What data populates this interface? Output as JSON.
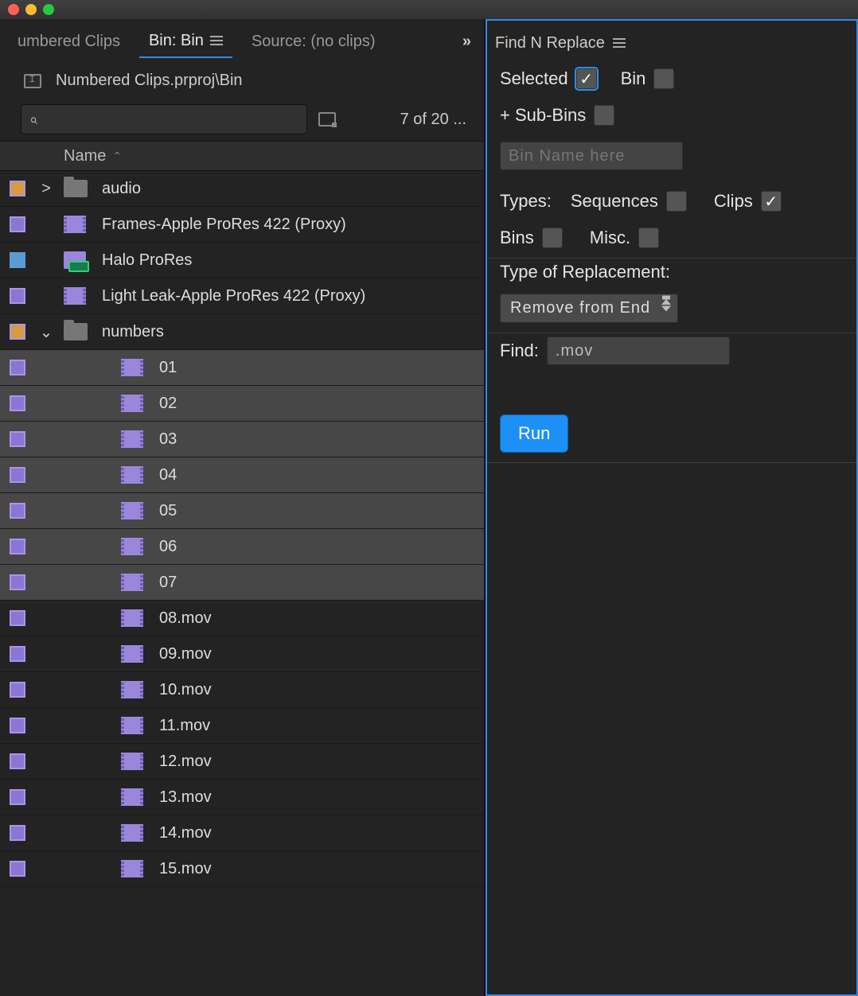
{
  "tabs": {
    "left": [
      {
        "label": "umbered Clips",
        "active": false,
        "menu": false
      },
      {
        "label": "Bin: Bin",
        "active": true,
        "menu": true
      },
      {
        "label": "Source: (no clips)",
        "active": false,
        "menu": false
      }
    ],
    "right": {
      "label": "Find N Replace"
    }
  },
  "breadcrumb": "Numbered Clips.prproj\\Bin",
  "search": {
    "placeholder": ""
  },
  "count_text": "7 of 20 ...",
  "list_header": {
    "col": "Name"
  },
  "rows": [
    {
      "kind": "folder",
      "name": "audio",
      "indent": 0,
      "chevron": ">",
      "selected": false
    },
    {
      "kind": "clip",
      "name": "Frames-Apple ProRes 422 (Proxy)",
      "indent": 0,
      "selected": false
    },
    {
      "kind": "seq",
      "name": "Halo ProRes",
      "indent": 0,
      "selected": false
    },
    {
      "kind": "clip",
      "name": "Light Leak-Apple ProRes 422 (Proxy)",
      "indent": 0,
      "selected": false
    },
    {
      "kind": "folder",
      "name": "numbers",
      "indent": 0,
      "chevron": "⌄",
      "selected": false
    },
    {
      "kind": "clip",
      "name": "01",
      "indent": 1,
      "selected": true
    },
    {
      "kind": "clip",
      "name": "02",
      "indent": 1,
      "selected": true
    },
    {
      "kind": "clip",
      "name": "03",
      "indent": 1,
      "selected": true
    },
    {
      "kind": "clip",
      "name": "04",
      "indent": 1,
      "selected": true
    },
    {
      "kind": "clip",
      "name": "05",
      "indent": 1,
      "selected": true
    },
    {
      "kind": "clip",
      "name": "06",
      "indent": 1,
      "selected": true
    },
    {
      "kind": "clip",
      "name": "07",
      "indent": 1,
      "selected": true
    },
    {
      "kind": "clip",
      "name": "08.mov",
      "indent": 1,
      "selected": false
    },
    {
      "kind": "clip",
      "name": "09.mov",
      "indent": 1,
      "selected": false
    },
    {
      "kind": "clip",
      "name": "10.mov",
      "indent": 1,
      "selected": false
    },
    {
      "kind": "clip",
      "name": "11.mov",
      "indent": 1,
      "selected": false
    },
    {
      "kind": "clip",
      "name": "12.mov",
      "indent": 1,
      "selected": false
    },
    {
      "kind": "clip",
      "name": "13.mov",
      "indent": 1,
      "selected": false
    },
    {
      "kind": "clip",
      "name": "14.mov",
      "indent": 1,
      "selected": false
    },
    {
      "kind": "clip",
      "name": "15.mov",
      "indent": 1,
      "selected": false
    }
  ],
  "rp": {
    "filter": {
      "selected_label": "Selected",
      "selected": true,
      "bin_label": "Bin",
      "bin": false,
      "subbins_label": "+ Sub-Bins",
      "subbins": false,
      "bin_placeholder": "Bin Name here"
    },
    "types": {
      "label": "Types:",
      "seq_label": "Sequences",
      "seq": false,
      "clips_label": "Clips",
      "clips": true,
      "bins_label": "Bins",
      "bins": false,
      "misc_label": "Misc.",
      "misc": false
    },
    "replacement": {
      "title": "Type of Replacement:",
      "value": "Remove from End"
    },
    "find": {
      "label": "Find:",
      "value": ".mov"
    },
    "run_label": "Run"
  }
}
